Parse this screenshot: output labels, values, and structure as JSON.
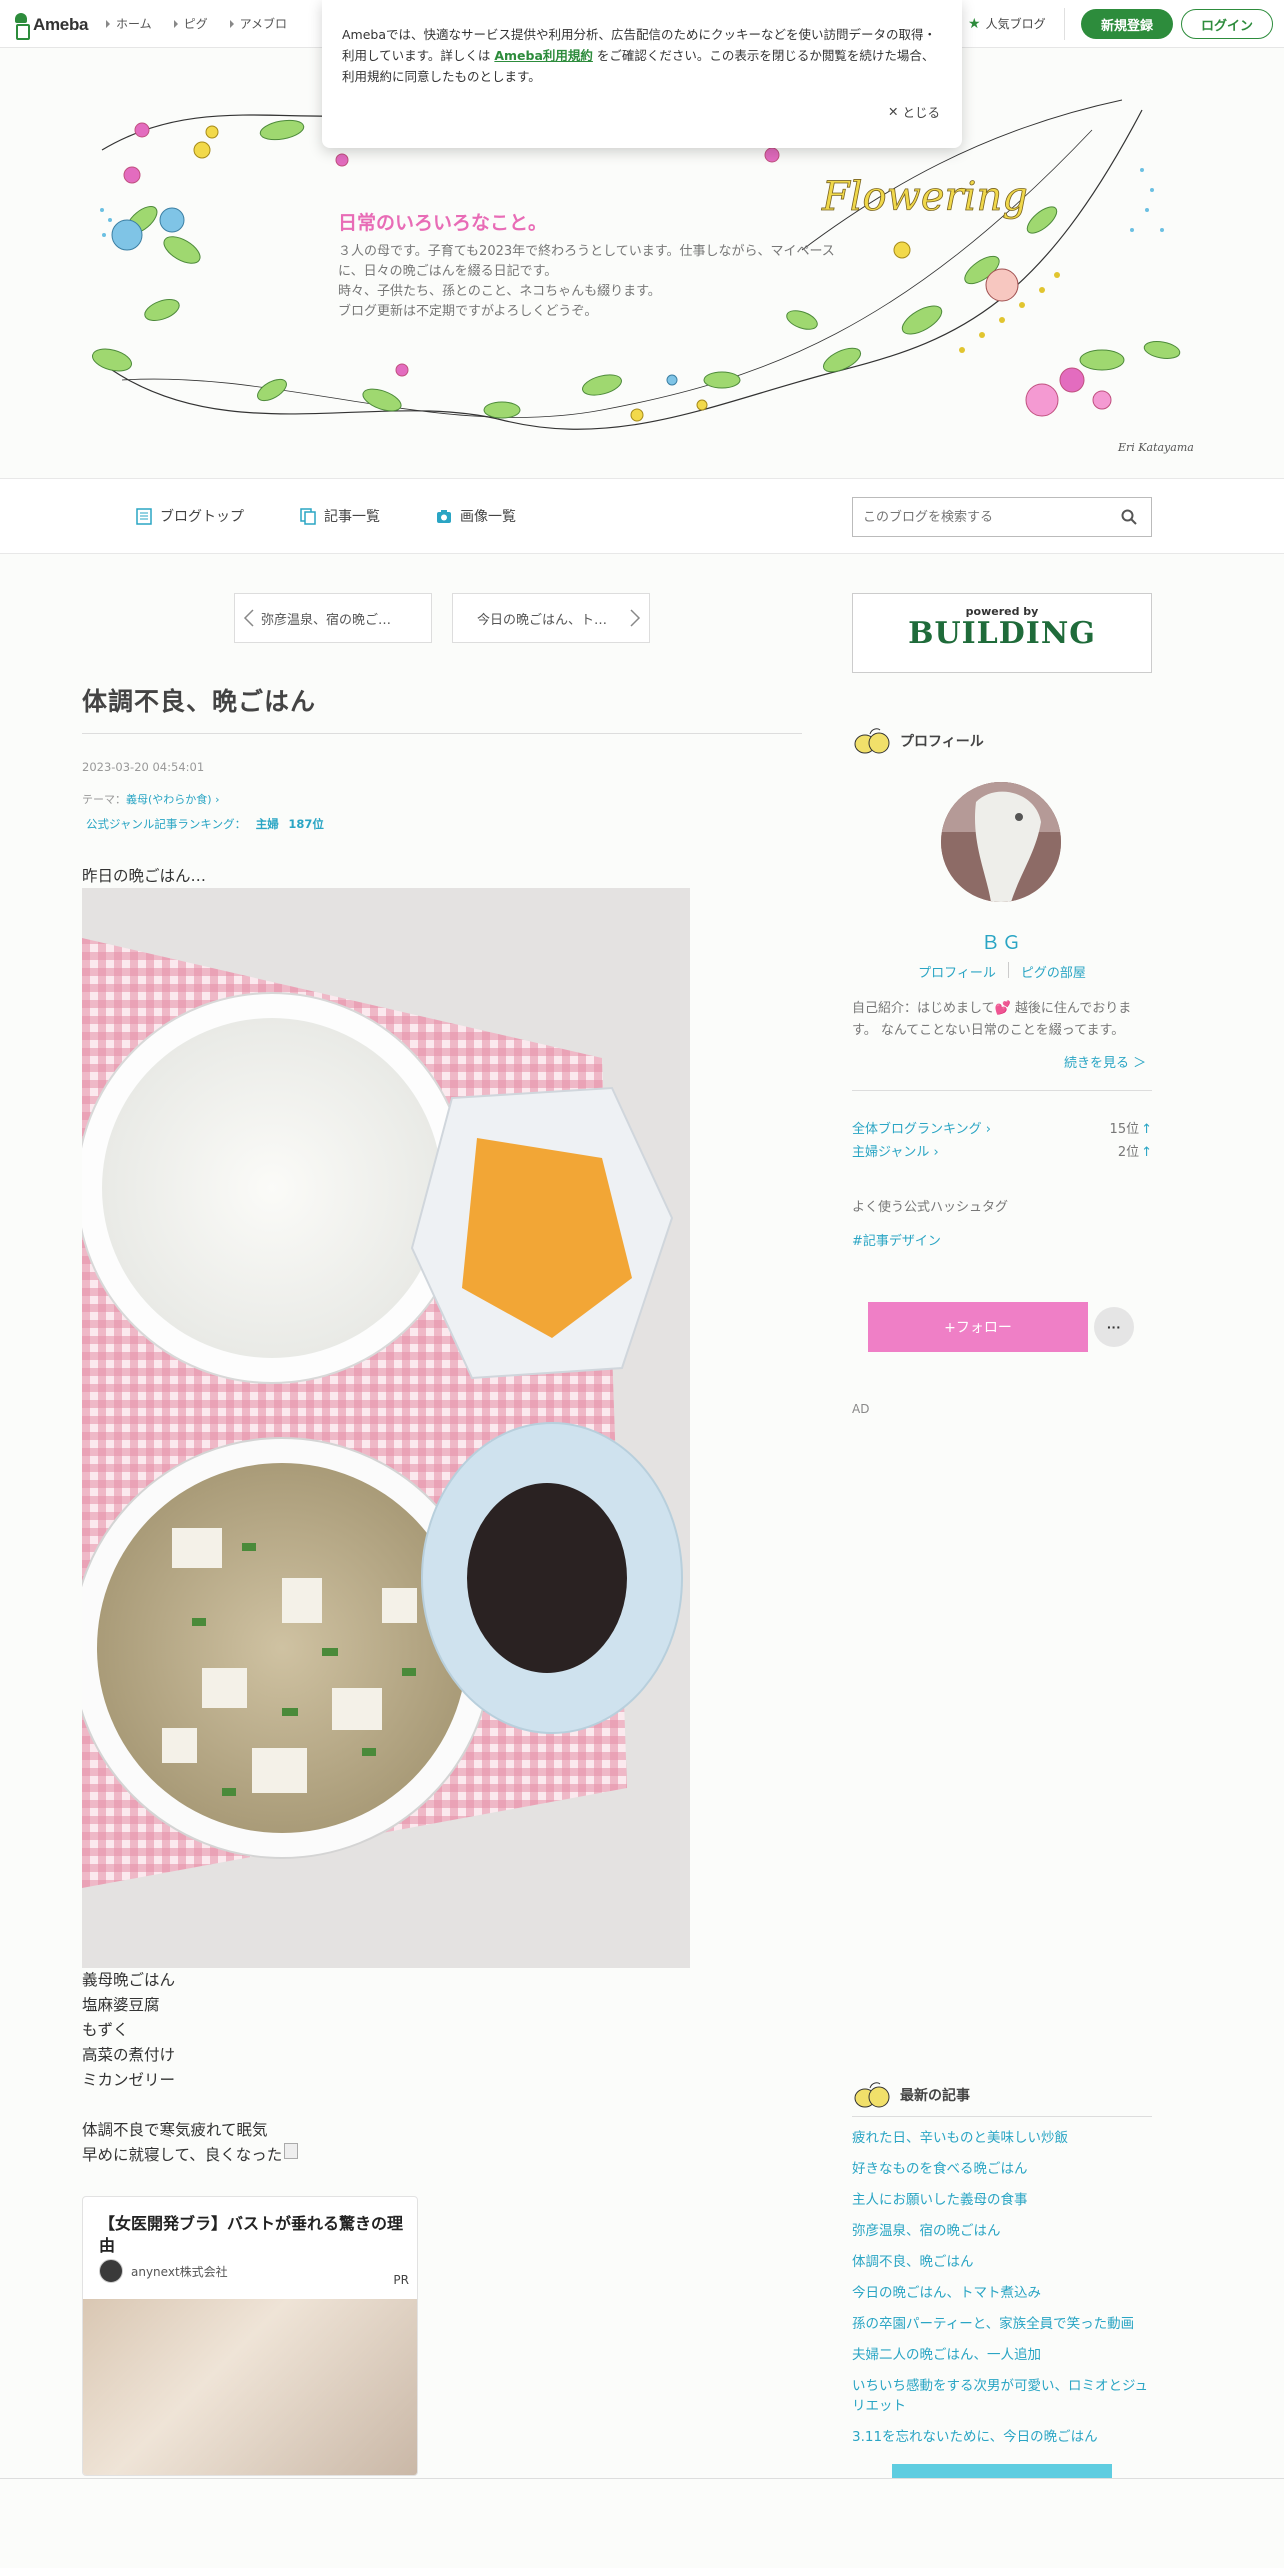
{
  "global_header": {
    "logo": "Ameba",
    "nav": [
      "ホーム",
      "ピグ",
      "アメブロ"
    ],
    "popular_label": "人気ブログ",
    "register_label": "新規登録",
    "login_label": "ログイン"
  },
  "cookie_notice": {
    "text_before": "Amebaでは、快適なサービス提供や利用分析、広告配信のためにクッキーなどを使い訪問データの取得・利用しています。詳しくは ",
    "link": "Ameba利用規約",
    "text_after": " をご確認ください。この表示を閉じるか閲覧を続けた場合、利用規約に同意したものとします。",
    "close_label": "とじる"
  },
  "banner": {
    "title": "日常のいろいろなこと。",
    "description": [
      "３人の母です。子育ても2023年で終わろうとしています。仕事しながら、マイペースに、日々の晩ごはんを綴る日記です。",
      "時々、子供たち、孫とのこと、ネコちゃんも綴ります。",
      "ブログ更新は不定期ですがよろしくどうぞ。"
    ],
    "deco_text": "Flowering",
    "signature": "Eri Katayama"
  },
  "blog_nav": {
    "items": [
      "ブログトップ",
      "記事一覧",
      "画像一覧"
    ],
    "search_placeholder": "このブログを検索する"
  },
  "article": {
    "prev_label": "弥彦温泉、宿の晩ご…",
    "next_label": "今日の晩ごはん、ト…",
    "title": "体調不良、晩ごはん",
    "date": "2023-03-20 04:54:01",
    "theme_prefix": "テーマ：",
    "theme": "義母(やわらか食)",
    "ranking_label": "公式ジャンル記事ランキング：",
    "ranking_genre": "主婦",
    "ranking_pos": "187位",
    "intro": "昨日の晩ごはん…",
    "menu": [
      "義母晩ごはん",
      "塩麻婆豆腐",
      "もずく",
      "高菜の煮付け",
      "ミカンゼリー"
    ],
    "closing": [
      "体調不良で寒気疲れて眠気",
      "早めに就寝して、良くなった"
    ]
  },
  "ad": {
    "headline": "【女医開発ブラ】バストが垂れる驚きの理由",
    "advertiser": "anynext株式会社",
    "pr": "PR"
  },
  "sidebar": {
    "powered_by": "powered by",
    "building": "BUILDING",
    "profile_heading": "プロフィール",
    "username": "ＢＧ",
    "profile_link": "プロフィール",
    "pig_link": "ピグの部屋",
    "intro": "自己紹介：はじめまして💕 越後に住んでおります。 なんてことない日常のことを綴ってます。",
    "more": "続きを見る ＞",
    "ranks": [
      {
        "label": "全体ブログランキング",
        "value": "15位",
        "arrow": "↑"
      },
      {
        "label": "主婦ジャンル",
        "value": "2位",
        "arrow": "↑"
      }
    ],
    "hashtag_heading": "よく使う公式ハッシュタグ",
    "hashtag": "#記事デザイン",
    "follow_label": "+フォロー",
    "more_label": "···",
    "ad_label": "AD",
    "recent_heading": "最新の記事",
    "recent": [
      "疲れた日、辛いものと美味しい炒飯",
      "好きなものを食べる晩ごはん",
      "主人にお願いした義母の食事",
      "弥彦温泉、宿の晩ごはん",
      "体調不良、晩ごはん",
      "今日の晩ごはん、トマト煮込み",
      "孫の卒園パーティーと、家族全員で笑った動画",
      "夫婦二人の晩ごはん、一人追加",
      "いちいち感動をする次男が可愛い、ロミオとジュリエット",
      "3.11を忘れないために、今日の晩ごはん"
    ]
  },
  "colors": {
    "ameba_green": "#2d8c3c",
    "link_teal": "#2aa5c4",
    "pink": "#e86cb6",
    "follow_pink": "#ef7fc6"
  }
}
